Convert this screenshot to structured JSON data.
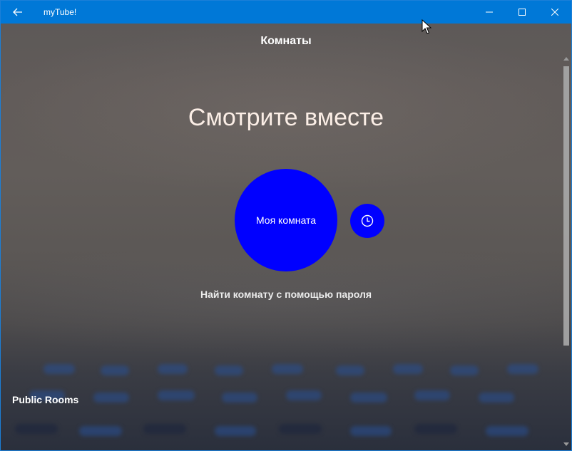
{
  "window": {
    "app_title": "myTube!",
    "back_icon": "arrow-left-icon",
    "minimize_icon": "minimize-icon",
    "maximize_icon": "maximize-icon",
    "close_icon": "close-icon"
  },
  "page": {
    "section_title": "Комнаты",
    "hero_title": "Смотрите вместе",
    "my_room_label": "Моя комната",
    "history_icon": "clock-icon",
    "find_room_label": "Найти комнату с помощью пароля",
    "public_rooms_label": "Public Rooms"
  },
  "colors": {
    "titlebar": "#0078d7",
    "accent_button": "#0000ff",
    "text_light": "#ffffff"
  }
}
